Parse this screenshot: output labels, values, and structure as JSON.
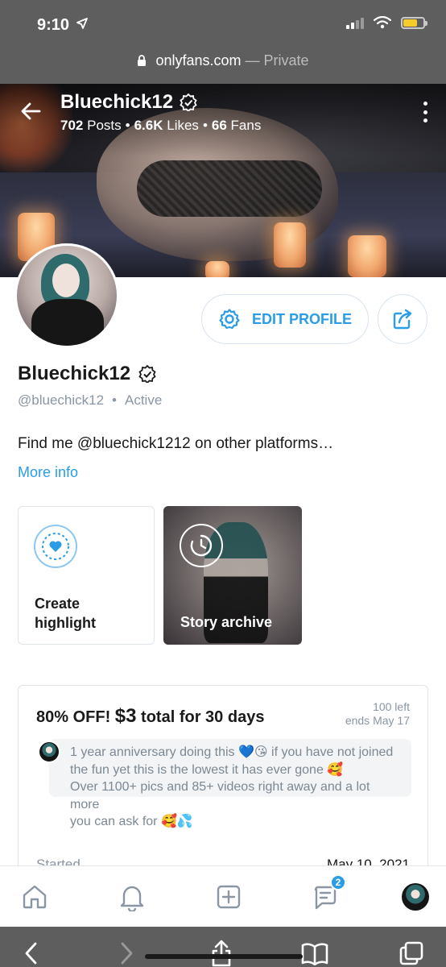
{
  "status_bar": {
    "time": "9:10"
  },
  "browser": {
    "domain": "onlyfans.com",
    "mode": "— Private"
  },
  "header": {
    "name": "Bluechick12",
    "posts_count": "702",
    "posts_label": "Posts",
    "likes_count": "6.6K",
    "likes_label": "Likes",
    "fans_count": "66",
    "fans_label": "Fans",
    "separator": "•"
  },
  "profile": {
    "edit_label": "EDIT PROFILE",
    "display_name": "Bluechick12",
    "handle": "@bluechick12",
    "handle_separator": "•",
    "status": "Active",
    "bio": "Find me @bluechick1212 on other platforms…",
    "more_info": "More info"
  },
  "highlights": {
    "create_label": "Create highlight",
    "archive_label": "Story archive"
  },
  "subscription": {
    "offer_prefix": "80% OFF! ",
    "price": "$3",
    "offer_suffix": " total for 30 days",
    "left": "100 left",
    "ends": "ends May 17",
    "message_line1": "1 year anniversary doing this 💙😘 if you have not joined",
    "message_line2": "the fun yet this is the lowest it has ever gone 🥰",
    "message_line3": "Over 1100+ pics and 85+ videos right away and a lot more",
    "message_line4": "you can ask for 🥰💦",
    "started_label": "Started",
    "started_date": "May 10, 2021"
  },
  "bottom_nav": {
    "messages_badge": "2"
  },
  "colors": {
    "accent": "#2a9de6",
    "muted": "#8a96a3",
    "chrome": "#5e5e5e"
  }
}
